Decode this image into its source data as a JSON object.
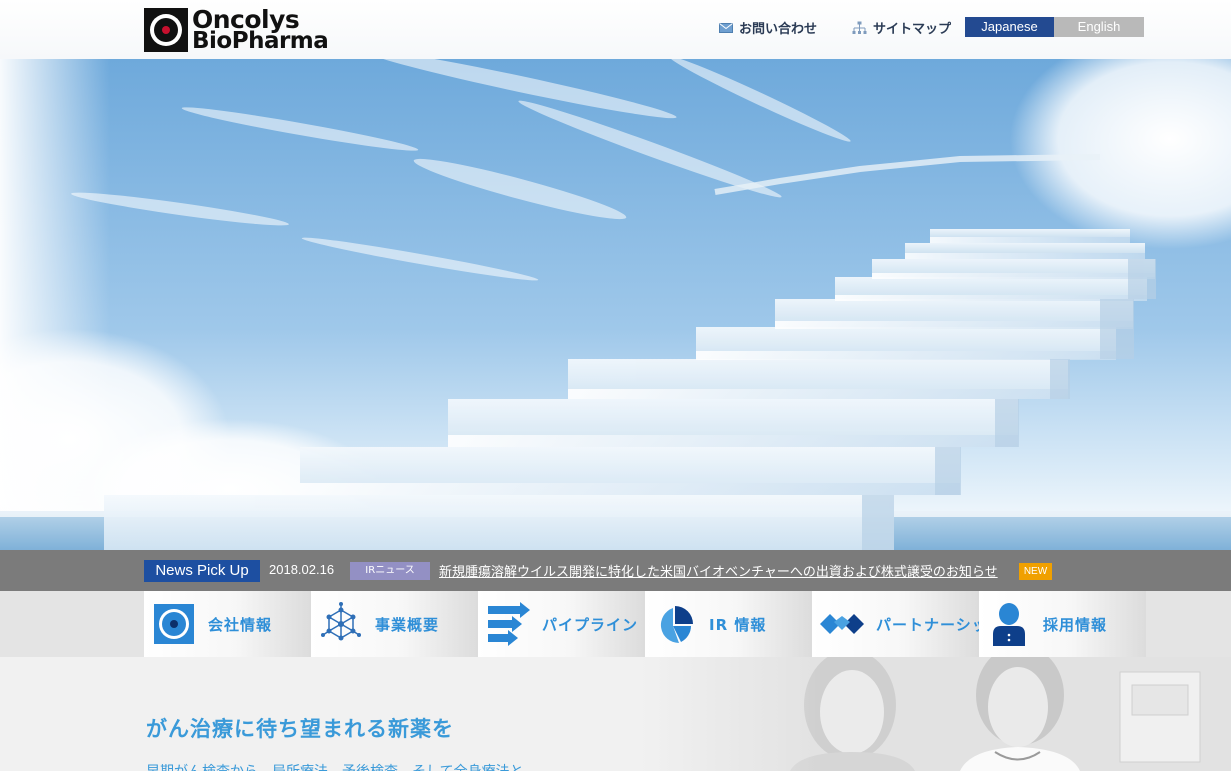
{
  "brand": {
    "name_line1": "Oncolys",
    "name_line2": "BioPharma",
    "colors": {
      "navy": "#234a91",
      "accent_blue": "#2f8fd8",
      "logo_red": "#c8102e"
    }
  },
  "header": {
    "contact_label": "お問い合わせ",
    "contact_icon": "mail-icon",
    "sitemap_label": "サイトマップ",
    "sitemap_icon": "sitemap-icon",
    "lang_japanese": "Japanese",
    "lang_english": "English",
    "active_language": "Japanese"
  },
  "news": {
    "title": "News Pick Up",
    "date": "2018.02.16",
    "category": "IRニュース",
    "headline": "新規腫瘍溶解ウイルス開発に特化した米国バイオベンチャーへの出資および株式譲受のお知らせ",
    "badge": "NEW"
  },
  "nav": {
    "items": [
      {
        "label": "会社情報",
        "icon": "circle-target-icon"
      },
      {
        "label": "事業概要",
        "icon": "molecule-network-icon"
      },
      {
        "label": "パイプライン",
        "icon": "pipeline-arrows-icon"
      },
      {
        "label": "IR 情報",
        "icon": "pie-chart-icon"
      },
      {
        "label": "パートナーシップ",
        "icon": "handshake-icon"
      },
      {
        "label": "採用情報",
        "icon": "person-icon"
      }
    ]
  },
  "content": {
    "heading": "がん治療に待ち望まれる新薬を",
    "body": "早期がん検査から、局所療法、予後検査、そして全身療法と"
  }
}
